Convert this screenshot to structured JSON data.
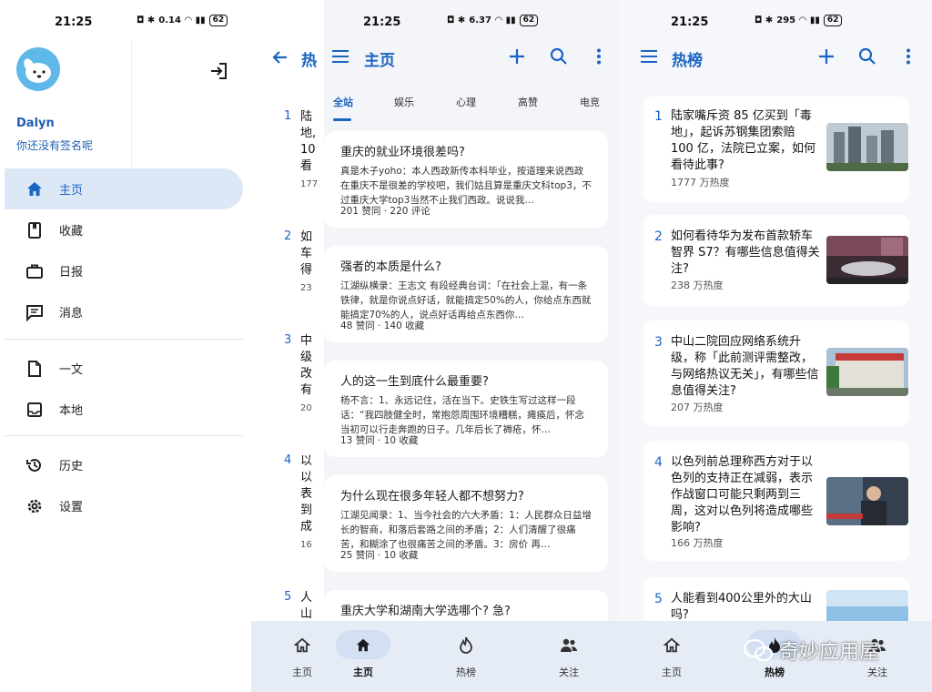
{
  "colors": {
    "accent": "#1a64c2",
    "active_nav_bg": "#dde8f6",
    "bottom_nav_bg": "#e6ecf6"
  },
  "status_bars": [
    {
      "time": "21:25",
      "speed": "0.14",
      "battery": "62"
    },
    {
      "time": "21:25",
      "speed": "6.37",
      "battery": "62"
    },
    {
      "time": "21:25",
      "speed": "295",
      "battery": "62"
    }
  ],
  "drawer": {
    "user_name": "Dalyn",
    "user_sign": "你还没有签名呢",
    "items": [
      {
        "icon": "home-icon",
        "label": "主页",
        "active": true
      },
      {
        "icon": "bookmark-icon",
        "label": "收藏"
      },
      {
        "icon": "briefcase-icon",
        "label": "日报"
      },
      {
        "icon": "message-icon",
        "label": "消息"
      },
      {
        "icon": "document-icon",
        "label": "一文"
      },
      {
        "icon": "inbox-icon",
        "label": "本地"
      },
      {
        "icon": "history-icon",
        "label": "历史"
      },
      {
        "icon": "settings-icon",
        "label": "设置"
      }
    ]
  },
  "behind_list": {
    "title": "热",
    "items": [
      {
        "rank": "1",
        "lines": [
          "陆",
          "地,",
          "10",
          "看"
        ],
        "heat": "177"
      },
      {
        "rank": "2",
        "lines": [
          "如",
          "车",
          "得"
        ],
        "heat": "23"
      },
      {
        "rank": "3",
        "lines": [
          "中",
          "级",
          "改",
          "有"
        ],
        "heat": "20"
      },
      {
        "rank": "4",
        "lines": [
          "以",
          "以",
          "表",
          "到",
          "成"
        ],
        "heat": "16"
      },
      {
        "rank": "5",
        "lines": [
          "人",
          "山"
        ],
        "heat": ""
      }
    ]
  },
  "home": {
    "title": "主页",
    "tabs": [
      "全站",
      "娱乐",
      "心理",
      "高赞",
      "电竞"
    ],
    "cards": [
      {
        "title": "重庆的就业环境很差吗?",
        "excerpt": "真是木子yoho：本人西政新传本科毕业，按道理来说西政在重庆不是很差的学校吧，我们姑且算是重庆文科top3，不过重庆大学top3当然不止我们西政。说说我…",
        "meta": "201 赞同 · 220 评论"
      },
      {
        "title": "强者的本质是什么?",
        "excerpt": "江湖纵横录：王志文 有段经典台词：「在社会上混，有一条铁律，就是你说点好话，就能搞定50%的人，你给点东西就能搞定70%的人，说点好话再给点东西你…",
        "meta": "48 赞同 · 140 收藏"
      },
      {
        "title": "人的这一生到底什么最重要?",
        "excerpt": "杨不言：1、永远记住，活在当下。史铁生写过这样一段话：“我四肢健全时，常抱怨周围环境糟糕，瘫痪后，怀念当初可以行走奔跑的日子。几年后长了褥疮，怀…",
        "meta": "13 赞同 · 10 收藏"
      },
      {
        "title": "为什么现在很多年轻人都不想努力?",
        "excerpt": "江湖见闻录：1、当今社会的六大矛盾：1：人民群众日益增长的智商，和落后套路之间的矛盾；2：人们清醒了很痛苦，和糊涂了也很痛苦之间的矛盾。3：房价 再…",
        "meta": "25 赞同 · 10 收藏"
      },
      {
        "title": "重庆大学和湖南大学选哪个? 急?",
        "excerpt": "",
        "meta": ""
      }
    ]
  },
  "hot": {
    "title": "热榜",
    "items": [
      {
        "rank": "1",
        "title": "陆家嘴斥资 85 亿买到「毒地」，起诉苏钢集团索赔 100 亿，法院已立案，如何看待此事?",
        "heat": "1777 万热度"
      },
      {
        "rank": "2",
        "title": "如何看待华为发布首款轿车智界 S7？有哪些信息值得关注?",
        "heat": "238 万热度"
      },
      {
        "rank": "3",
        "title": "中山二院回应网络系统升级，称「此前测评需整改，与网络热议无关」，有哪些信息值得关注?",
        "heat": "207 万热度"
      },
      {
        "rank": "4",
        "title": "以色列前总理称西方对于以色列的支持正在减弱，表示作战窗口可能只剩两到三周，这对以色列将造成哪些影响?",
        "heat": "166 万热度"
      },
      {
        "rank": "5",
        "title": "人能看到400公里外的大山吗?",
        "heat": ""
      }
    ]
  },
  "bottom_nav": {
    "labels": [
      "主页",
      "热榜",
      "关注"
    ],
    "home_active_label": "主页",
    "hot_active_label": "热榜"
  },
  "watermark": "奇妙应用屋"
}
